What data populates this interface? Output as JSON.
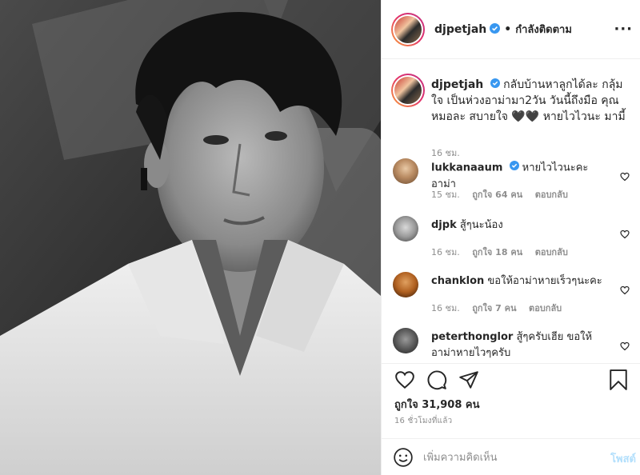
{
  "header": {
    "username": "djpetjah",
    "separator": "•",
    "follow_status": "กำลังติดตาม",
    "more_icon": "more-options-icon"
  },
  "caption": {
    "username": "djpetjah",
    "text": "กลับบ้านหาลูกได้ละ กลุ้มใจ เป็นห่วงอาม่ามา2วัน วันนี้ถึงมือ คุณหมอละ สบายใจ 🖤🖤 หายไวไวนะ มามี้",
    "time": "16 ชม."
  },
  "comments": [
    {
      "username": "lukkanaaum",
      "verified": true,
      "text": "หายไวไวนะคะอาม่า",
      "time": "15 ชม.",
      "likes": "ถูกใจ 64 คน",
      "reply": "ตอบกลับ"
    },
    {
      "username": "djpk",
      "verified": false,
      "text": "สู้ๆนะน้อง",
      "time": "16 ชม.",
      "likes": "ถูกใจ 18 คน",
      "reply": "ตอบกลับ"
    },
    {
      "username": "chanklon",
      "verified": false,
      "text": "ขอให้อาม่าหายเร็วๆนะคะ",
      "time": "16 ชม.",
      "likes": "ถูกใจ 7 คน",
      "reply": "ตอบกลับ"
    },
    {
      "username": "peterthonglor",
      "verified": false,
      "text": "สู้ๆครับเฮีย ขอให้อาม่าหายไวๆครับ",
      "time": "",
      "likes": "",
      "reply": ""
    }
  ],
  "actions": {
    "like_icon": "heart-icon",
    "comment_icon": "comment-icon",
    "share_icon": "share-icon",
    "save_icon": "bookmark-icon",
    "likes_text": "ถูกใจ 31,908 คน",
    "time_ago": "16 ชั่วโมงที่แล้ว"
  },
  "add_comment": {
    "emoji_icon": "emoji-icon",
    "placeholder": "เพิ่มความคิดเห็น",
    "post_label": "โพสต์"
  },
  "colors": {
    "verified": "#3897f0",
    "post_button": "#b2dffc",
    "muted": "#8e8e8e"
  }
}
